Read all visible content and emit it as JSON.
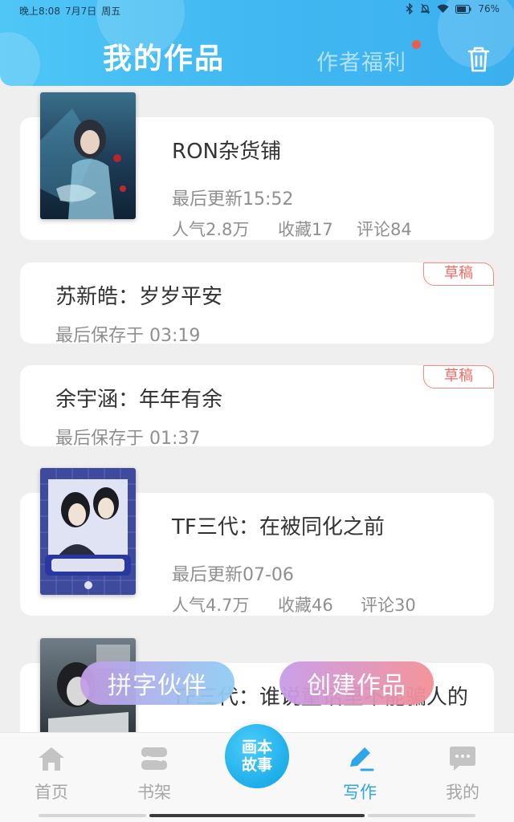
{
  "status_bar": {
    "time": "晚上8:08",
    "date": "7月7日",
    "weekday": "周五",
    "battery": "76%"
  },
  "header": {
    "title": "我的作品",
    "benefit_label": "作者福利",
    "accent": "#41b8f2"
  },
  "works": [
    {
      "type": "published",
      "title": "RON杂货铺",
      "updated": "最后更新15:52",
      "popularity": "人气2.8万",
      "favorites": "收藏17",
      "comments": "评论84",
      "cover_icon": "book-cover-image"
    },
    {
      "type": "draft",
      "title": "苏新皓：岁岁平安",
      "saved": "最后保存于 03:19",
      "badge": "草稿"
    },
    {
      "type": "draft",
      "title": "余宇涵：年年有余",
      "saved": "最后保存于 01:37",
      "badge": "草稿"
    },
    {
      "type": "published",
      "title": "TF三代：在被同化之前",
      "updated": "最后更新07-06",
      "popularity": "人气4.7万",
      "favorites": "收藏46",
      "comments": "评论30",
      "cover_icon": "book-cover-image"
    },
    {
      "type": "published",
      "title": "TF三代：谁说童话里不能骗人的",
      "cover_icon": "book-cover-image"
    }
  ],
  "floating_buttons": {
    "partner": "拼字伙伴",
    "create": "创建作品"
  },
  "bottom_nav": {
    "items": [
      {
        "label": "首页",
        "icon": "home-icon"
      },
      {
        "label": "书架",
        "icon": "bookshelf-icon"
      },
      {
        "label": "写作",
        "icon": "pen-icon",
        "active": true
      },
      {
        "label": "我的",
        "icon": "chat-bubble-icon"
      }
    ],
    "center_line1": "画本",
    "center_line2": "故事"
  }
}
